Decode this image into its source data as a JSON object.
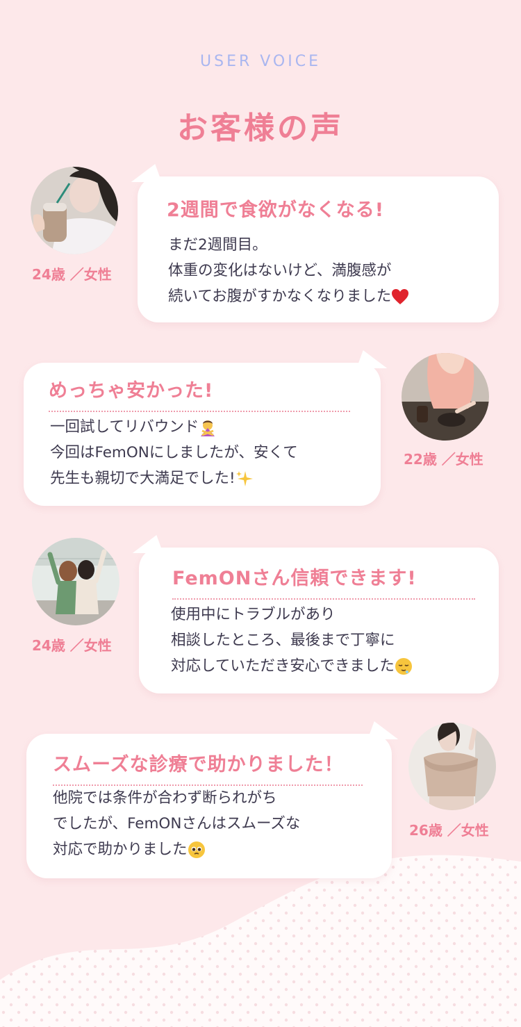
{
  "section": {
    "eyebrow": "USER VOICE",
    "title": "お客様の声"
  },
  "reviews": [
    {
      "age": "24歳 ／女性",
      "heading": "2週間で食欲がなくなる!",
      "lines": [
        "まだ2週間目。",
        "体重の変化はないけど、満腹感が",
        "続いてお腹がすかなくなりました"
      ],
      "emoji": "heart-icon"
    },
    {
      "age": "22歳 ／女性",
      "heading": "めっちゃ安かった!",
      "lines": [
        "一回試してリバウンド",
        "今回はFemONにしましたが、安くて",
        "先生も親切で大満足でした!"
      ],
      "emoji": "sparkles-icon"
    },
    {
      "age": "24歳 ／女性",
      "heading": "FemONさん信頼できます!",
      "lines": [
        "使用中にトラブルがあり",
        "相談したところ、最後まで丁寧に",
        "対応していただき安心できました"
      ],
      "emoji": "relieved-face-icon"
    },
    {
      "age": "26歳 ／女性",
      "heading": "スムーズな診療で助かりました！",
      "lines": [
        "他院では条件が合わず断られがち",
        "でしたが、FemONさんはスムーズな",
        "対応で助かりました"
      ],
      "emoji": "pleading-face-icon"
    }
  ],
  "colors": {
    "background": "#fde8ea",
    "accent": "#ef7f95",
    "eyebrow": "#a9b6f0",
    "text": "#3e3a4f"
  }
}
